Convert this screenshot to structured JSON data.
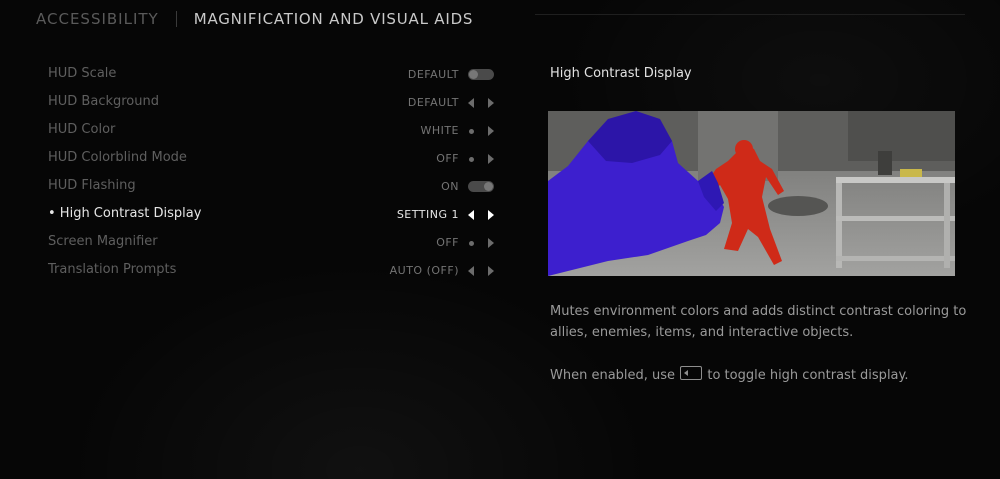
{
  "header": {
    "category": "ACCESSIBILITY",
    "title": "MAGNIFICATION AND VISUAL AIDS"
  },
  "menu": {
    "items": [
      {
        "label": "HUD Scale",
        "value": "DEFAULT",
        "control": "toggle-off"
      },
      {
        "label": "HUD Background",
        "value": "DEFAULT",
        "control": "arrows"
      },
      {
        "label": "HUD Color",
        "value": "WHITE",
        "control": "dot-arrow"
      },
      {
        "label": "HUD Colorblind Mode",
        "value": "OFF",
        "control": "dot-arrow"
      },
      {
        "label": "HUD Flashing",
        "value": "ON",
        "control": "toggle-on"
      },
      {
        "label": "• High Contrast Display",
        "value": "SETTING 1",
        "control": "arrows",
        "selected": true
      },
      {
        "label": "Screen Magnifier",
        "value": "OFF",
        "control": "dot-arrow"
      },
      {
        "label": "Translation Prompts",
        "value": "AUTO (OFF)",
        "control": "arrows"
      }
    ]
  },
  "detail": {
    "title": "High Contrast Display",
    "description": "Mutes environment colors and adds distinct contrast coloring to allies, enemies, items, and interactive objects.",
    "hint_before": "When enabled, use",
    "hint_key_icon": "left-arrow-key-icon",
    "hint_after": "to toggle high contrast display."
  },
  "colors": {
    "ally_highlight": "#3a1fd0",
    "enemy_highlight": "#d02a1a",
    "environment": "#8a8a88"
  }
}
